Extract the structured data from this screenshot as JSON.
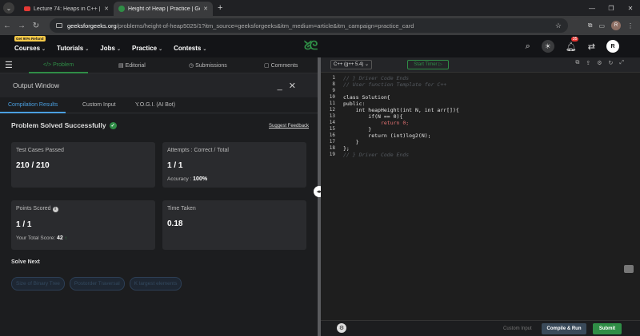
{
  "browser": {
    "tabs": [
      {
        "title": "Lecture 74: Heaps in C++ || He",
        "icon": "youtube-icon"
      },
      {
        "title": "Height of Heap | Practice | Gee",
        "icon": "gfg-icon"
      }
    ],
    "url_host": "geeksforgeeks.org",
    "url_path": "/problems/height-of-heap5025/1?itm_source=geeksforgeeks&itm_medium=article&itm_campaign=practice_card",
    "profile_initial": "R"
  },
  "site": {
    "refund_badge": "Get 90% Refund",
    "menu": [
      "Courses",
      "Tutorials",
      "Jobs",
      "Practice",
      "Contests"
    ],
    "notification_count": "35",
    "avatar_initial": "R"
  },
  "problem_tabs": [
    "Problem",
    "Editorial",
    "Submissions",
    "Comments"
  ],
  "output": {
    "title": "Output Window",
    "tabs": [
      "Compilation Results",
      "Custom Input",
      "Y.O.G.I. (AI Bot)"
    ],
    "status": "Problem Solved Successfully",
    "suggest": "Suggest Feedback",
    "cards": {
      "tests_label": "Test Cases Passed",
      "tests_value": "210 / 210",
      "attempts_label": "Attempts : Correct / Total",
      "attempts_value": "1 / 1",
      "accuracy_label": "Accuracy :",
      "accuracy_value": "100%",
      "points_label": "Points Scored",
      "points_value": "1 / 1",
      "total_label": "Your Total Score:",
      "total_value": "42",
      "time_label": "Time Taken",
      "time_value": "0.18"
    },
    "solve_next": "Solve Next",
    "next_problems": [
      "Size of Binary Tree",
      "Postorder Traversal",
      "K largest elements"
    ]
  },
  "editor": {
    "language": "C++ (g++ 5.4)",
    "timer": "Start Timer",
    "line_numbers": [
      "1",
      "8",
      "9",
      "10",
      "11",
      "12",
      "13",
      "14",
      "15",
      "16",
      "17",
      "18",
      "19"
    ],
    "lines": [
      "// } Driver Code Ends",
      "// User function Template for C++",
      "",
      "class Solution{",
      "public:",
      "    int heapHeight(int N, int arr[]){",
      "        if(N == 0){",
      "            return 0;",
      "        }",
      "        return (int)log2(N);",
      "    }",
      "};",
      "// } Driver Code Ends"
    ],
    "custom_input": "Custom Input",
    "compile": "Compile & Run",
    "submit": "Submit"
  }
}
